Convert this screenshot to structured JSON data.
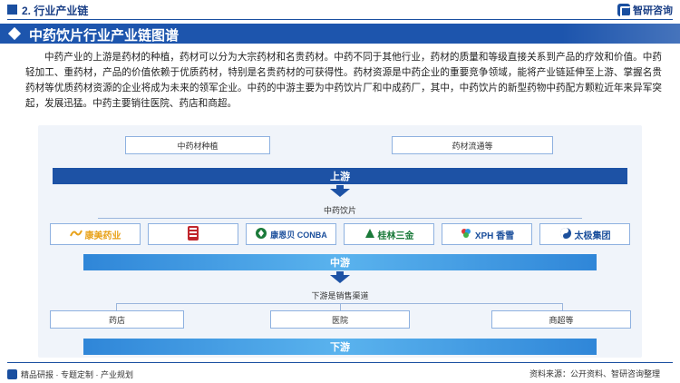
{
  "header": {
    "section_label": "2. 行业产业链",
    "logo_text": "智研咨询"
  },
  "title": "中药饮片行业产业链图谱",
  "intro": "中药产业的上游是药材的种植，药材可以分为大宗药材和名贵药材。中药不同于其他行业，药材的质量和等级直接关系到产品的疗效和价值。中药轻加工、重药材，产品的价值依赖于优质药材，特别是名贵药材的可获得性。药材资源是中药企业的重要竞争领域，能将产业链延伸至上游、掌握名贵药材等优质药材资源的企业将成为未来的领军企业。中药的中游主要为中药饮片厂和中成药厂，其中，中药饮片的新型药物中药配方颗粒近年来异军突起，发展迅猛。中药主要销往医院、药店和商超。",
  "diagram": {
    "upstream_boxes": [
      "中药材种植",
      "药材流通等"
    ],
    "upstream_label": "上游",
    "midstream_sub_label": "中药饮片",
    "brands": [
      {
        "text": "康美药业",
        "color": "#e8a21a"
      },
      {
        "text": "",
        "color": "#c0262d"
      },
      {
        "text": "康恩贝 CONBA",
        "color": "#1b4f9c"
      },
      {
        "text": "桂林三金",
        "color": "#1b7a3a"
      },
      {
        "text": "XPH 香雪",
        "color": "#1b4f9c"
      },
      {
        "text": "太极集团",
        "color": "#1b4f9c"
      }
    ],
    "midstream_label": "中游",
    "downstream_sub_label": "下游是销售渠道",
    "downstream_boxes": [
      "药店",
      "医院",
      "商超等"
    ],
    "downstream_label": "下游"
  },
  "footer": {
    "left_text": "精品研报 · 专题定制 · 产业规划",
    "source_text": "资料来源：公开资料、智研咨询整理"
  },
  "colors": {
    "brand_blue": "#1d55ad",
    "bar_dark": "#1d52a5",
    "bar_light": "#3a96e0"
  }
}
